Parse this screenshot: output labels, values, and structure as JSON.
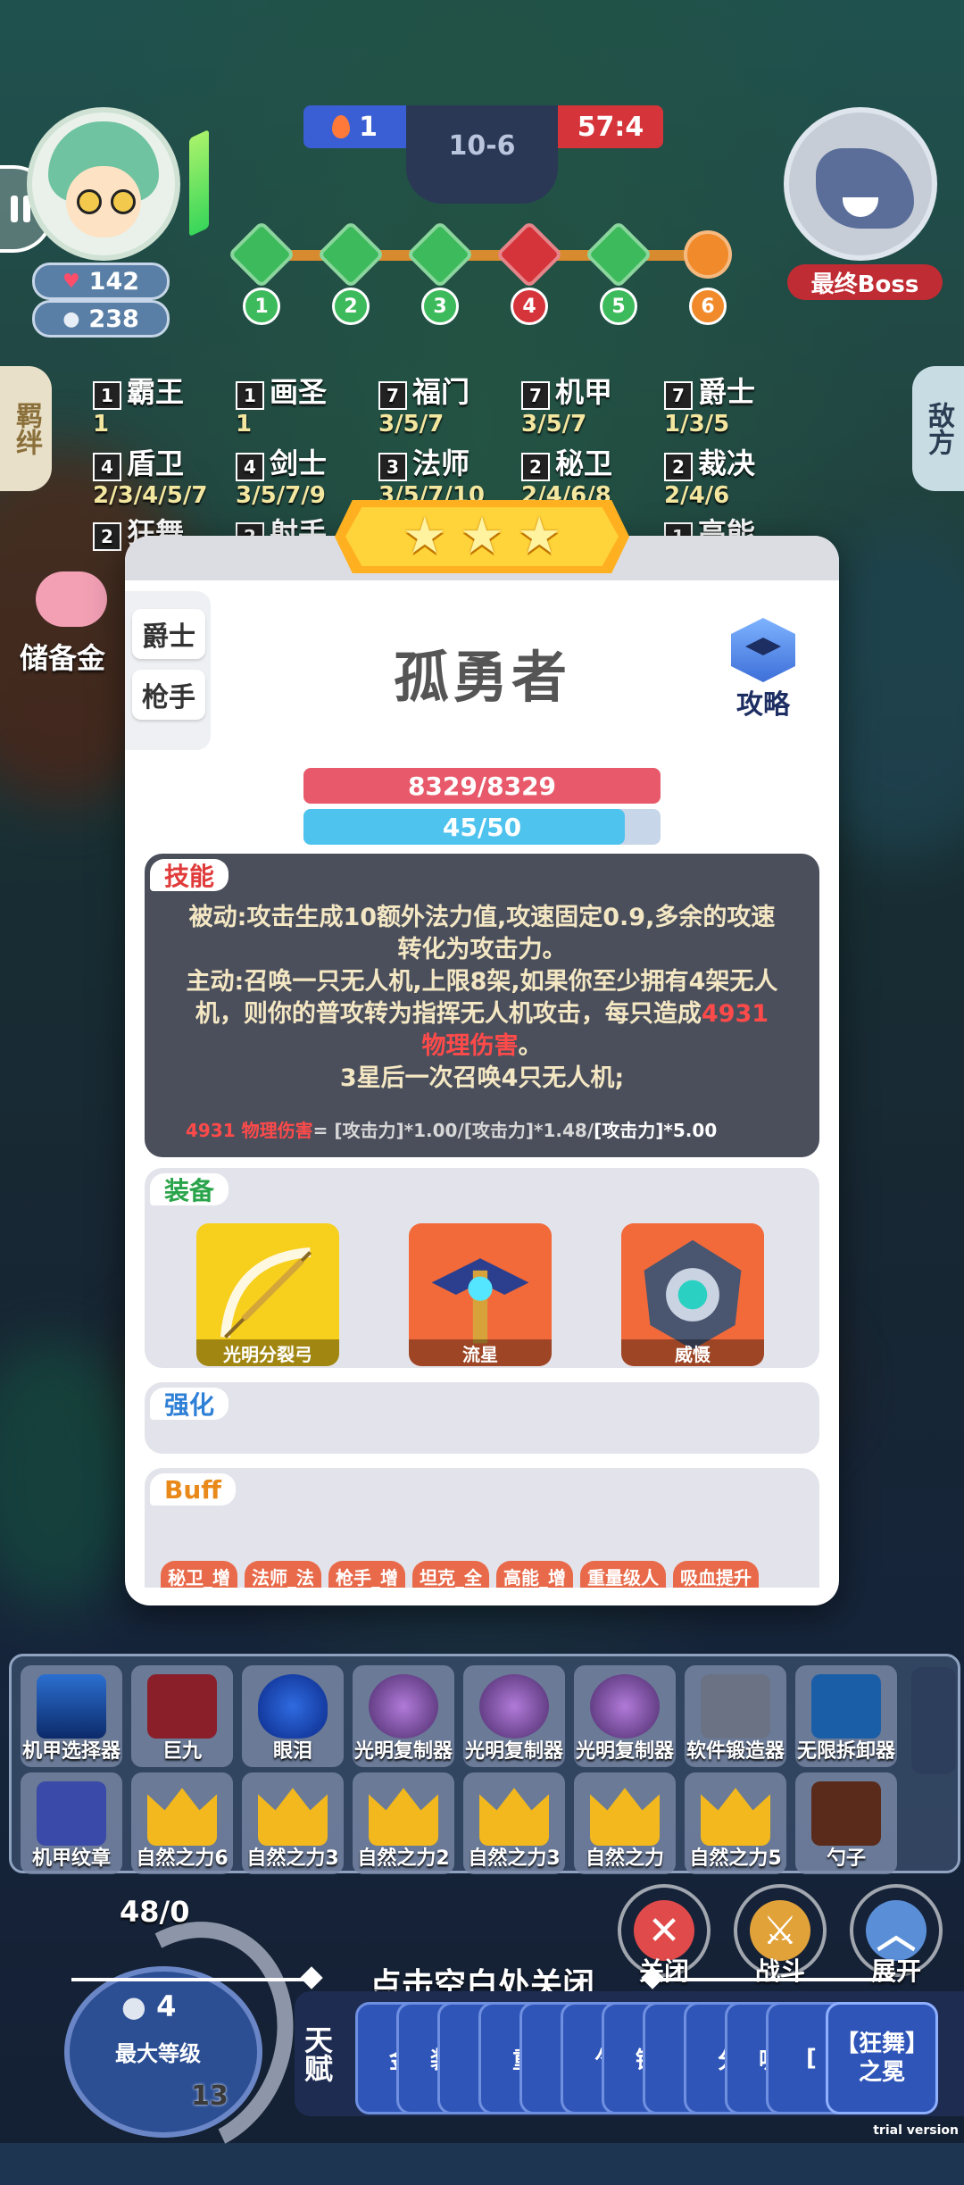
{
  "player": {
    "hp": "142",
    "coins": "238"
  },
  "score": {
    "left": "1",
    "mid": "10-6",
    "right": "57:4"
  },
  "boss": {
    "label": "最终Boss"
  },
  "rounds": [
    "1",
    "2",
    "3",
    "4",
    "5",
    "6"
  ],
  "side_tabs": {
    "left": "羁绊",
    "right": "敌方"
  },
  "synergies": [
    {
      "count": "1",
      "name": "霸王",
      "sub": "1"
    },
    {
      "count": "1",
      "name": "画圣",
      "sub": "1"
    },
    {
      "count": "7",
      "name": "福门",
      "sub": "3/5/7"
    },
    {
      "count": "7",
      "name": "机甲",
      "sub": "3/5/7"
    },
    {
      "count": "7",
      "name": "爵士",
      "sub": "1/3/5"
    },
    {
      "count": "4",
      "name": "盾卫",
      "sub": "2/3/4/5/7"
    },
    {
      "count": "4",
      "name": "剑士",
      "sub": "3/5/7/9"
    },
    {
      "count": "3",
      "name": "法师",
      "sub": "3/5/7/10"
    },
    {
      "count": "2",
      "name": "秘卫",
      "sub": "2/4/6/8"
    },
    {
      "count": "2",
      "name": "裁决",
      "sub": "2/4/6"
    },
    {
      "count": "2",
      "name": "狂舞",
      "sub": ""
    },
    {
      "count": "2",
      "name": "射手",
      "sub": ""
    },
    {
      "count": "1",
      "name": "高能",
      "sub": ""
    }
  ],
  "piggy_label": "储备金",
  "modal": {
    "stars": 3,
    "traits": [
      "爵士",
      "枪手"
    ],
    "hero_name": "孤勇者",
    "guide_label": "攻略",
    "hp_text": "8329/8329",
    "mp_text": "45/50",
    "mp_fraction": 0.9,
    "skill": {
      "tag": "技能",
      "passive": "被动:攻击生成10额外法力值,攻速固定0.9,多余的攻速转化为攻击力。",
      "active_pre": "主动:召唤一只无人机,上限8架,如果你至少拥有4架无人机，则你的普攻转为指挥无人机攻击，每只造成",
      "active_dmg": "4931 物理伤害",
      "active_post": "。",
      "star3": "3星后一次召唤4只无人机;",
      "formula_dmg": "4931 物理伤害",
      "formula_eq": "= [攻击力]*1.00/[攻击力]*1.48/",
      "formula_last": "[攻击力]*5.00"
    },
    "equip_tag": "装备",
    "equipment": [
      {
        "name": "光明分裂弓",
        "color": "#f7cf1d"
      },
      {
        "name": "流星",
        "color": "#f26a3a"
      },
      {
        "name": "威慑",
        "color": "#f26a3a"
      }
    ],
    "strengthen_tag": "强化",
    "buff_tag": "Buff",
    "buffs": [
      "秘卫_增",
      "法师_法",
      "枪手_增",
      "坦克_全",
      "高能_增",
      "重量级人",
      "吸血提升"
    ]
  },
  "inventory": {
    "row1": [
      "机甲选择器",
      "巨九",
      "眼泪",
      "光明复制器",
      "光明复制器",
      "光明复制器",
      "软件锻造器",
      "无限拆卸器"
    ],
    "row2": [
      "机甲纹章",
      "自然之力6",
      "自然之力3",
      "自然之力2",
      "自然之力3",
      "自然之力",
      "自然之力5",
      "勺子"
    ]
  },
  "level": {
    "top": "48/0",
    "coins": "4",
    "label": "最大等级",
    "num": "13"
  },
  "buttons": {
    "close": "关闭",
    "fight": "战斗",
    "expand": "展开"
  },
  "close_hint": "点击空白处关闭",
  "talent": {
    "label": "天赋",
    "cards": [
      "金",
      "装",
      "[",
      "重",
      "[",
      "勺",
      "锻",
      "[",
      "分",
      "吸",
      "["
    ],
    "last": "【狂舞】之冕"
  },
  "trial": "trial version"
}
